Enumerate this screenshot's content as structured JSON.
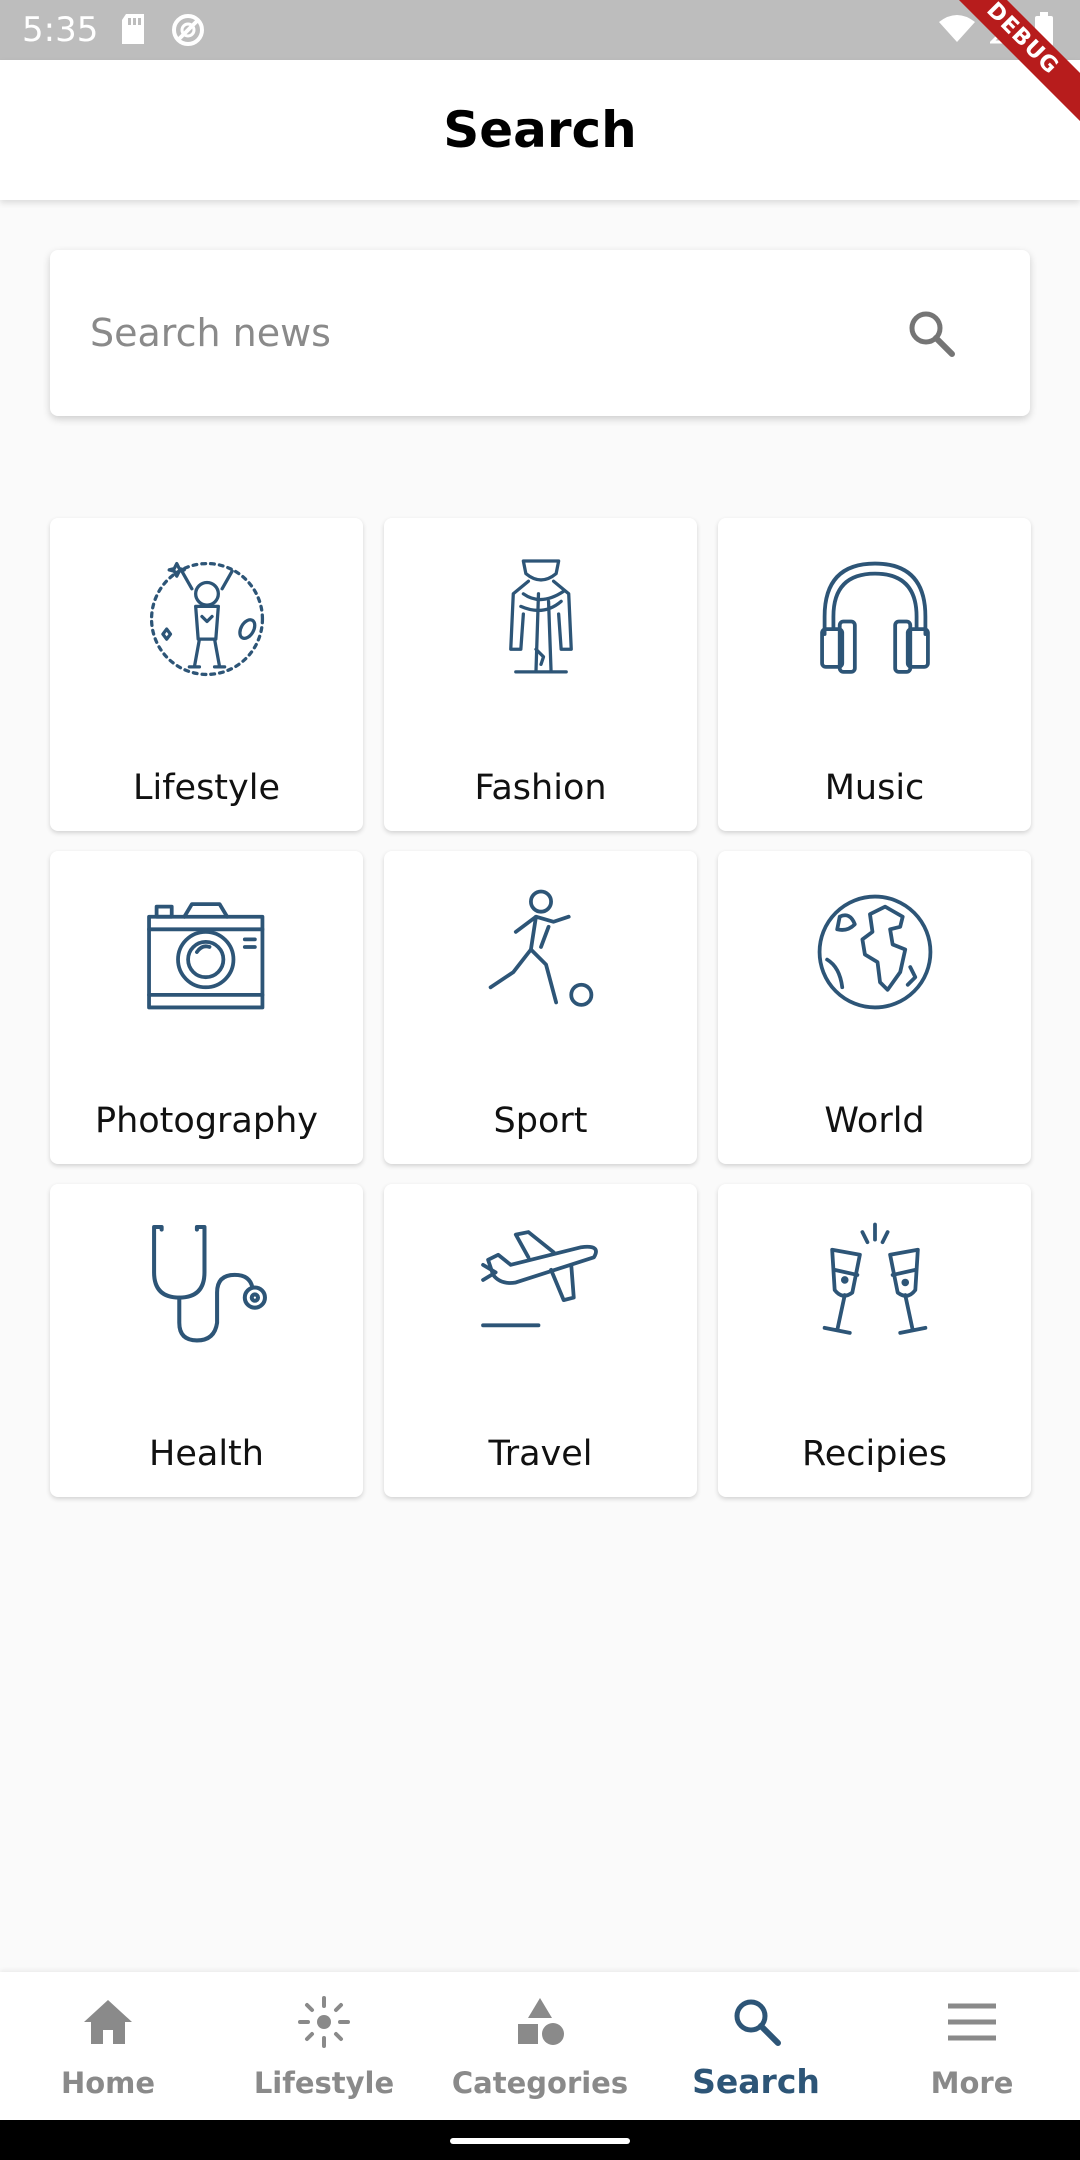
{
  "status_bar": {
    "time": "5:35",
    "debug_label": "DEBUG"
  },
  "app_bar": {
    "title": "Search"
  },
  "search": {
    "placeholder": "Search news",
    "value": ""
  },
  "categories": [
    {
      "label": "Lifestyle",
      "icon": "lifestyle-icon"
    },
    {
      "label": "Fashion",
      "icon": "fashion-icon"
    },
    {
      "label": "Music",
      "icon": "headphones-icon"
    },
    {
      "label": "Photography",
      "icon": "camera-icon"
    },
    {
      "label": "Sport",
      "icon": "soccer-player-icon"
    },
    {
      "label": "World",
      "icon": "globe-icon"
    },
    {
      "label": "Health",
      "icon": "stethoscope-icon"
    },
    {
      "label": "Travel",
      "icon": "airplane-icon"
    },
    {
      "label": "Recipies",
      "icon": "champagne-glasses-icon"
    }
  ],
  "bottom_nav": {
    "items": [
      {
        "label": "Home",
        "icon": "home-icon"
      },
      {
        "label": "Lifestyle",
        "icon": "sun-icon"
      },
      {
        "label": "Categories",
        "icon": "shapes-icon"
      },
      {
        "label": "Search",
        "icon": "search-icon"
      },
      {
        "label": "More",
        "icon": "menu-icon"
      }
    ],
    "active": "Search"
  },
  "colors": {
    "accent": "#2d5577",
    "icon_stroke": "#2d5577",
    "inactive": "#8a8a8a",
    "background": "#fafafa"
  }
}
